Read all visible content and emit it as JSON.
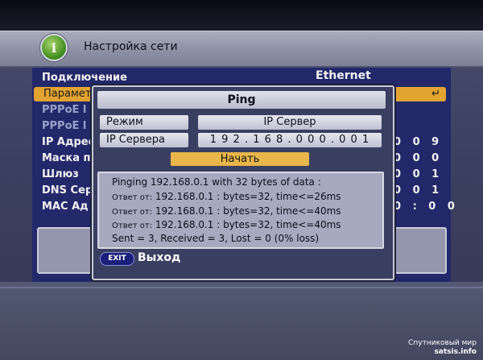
{
  "header": {
    "title": "Настройка сети",
    "logo_icon": "info-i-icon"
  },
  "menu": {
    "rows": [
      {
        "label": "Подключение",
        "value": "Ethernet"
      },
      {
        "label": "Параметр",
        "selected": true
      },
      {
        "label": "PPPoE l"
      },
      {
        "label": "PPPoE l"
      },
      {
        "label": "IP Адрес",
        "value": "0 0 9"
      },
      {
        "label": "Маска по",
        "value": "0 0 0"
      },
      {
        "label": "Шлюз",
        "value": "0 0 1"
      },
      {
        "label": "DNS Сер",
        "value": "0 0 1"
      },
      {
        "label": "MAC Ад",
        "value": "0 : 0 0"
      }
    ]
  },
  "dialog": {
    "title": "Ping",
    "mode_label": "Режим",
    "mode_value": "IP Сервер",
    "server_label": "IP Сервера",
    "server_value": "1 9 2 . 1 6 8 . 0 0 0 . 0 0 1",
    "start_button": "Начать",
    "output": {
      "line1": "Pinging 192.168.0.1 with 32 bytes of data :",
      "reply_prefix": "Ответ от:",
      "reply1": "192.168.0.1 : bytes=32, time<=26ms",
      "reply2": "192.168.0.1 : bytes=32, time<=40ms",
      "reply3": "192.168.0.1 : bytes=32, time<=40ms",
      "summary": "Sent = 3, Received = 3, Lost = 0 (0% loss)"
    }
  },
  "footer": {
    "exit_key": "EXIT",
    "exit_label": "Выход"
  },
  "watermark": {
    "line1": "Спутниковый мир",
    "line2": "satsis.info"
  },
  "colors": {
    "highlight": "#e2a431",
    "menu_bg": "#23286b",
    "start_button": "#e8b64a"
  }
}
